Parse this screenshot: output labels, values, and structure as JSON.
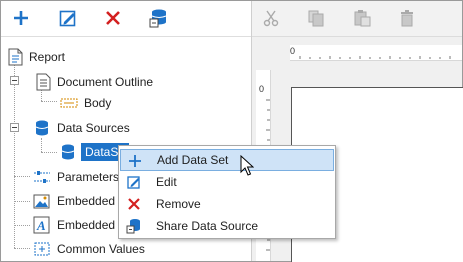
{
  "toolbar_left": {
    "buttons": [
      {
        "icon": "plus-icon"
      },
      {
        "icon": "edit-icon"
      },
      {
        "icon": "delete-icon"
      },
      {
        "icon": "data-source-icon"
      }
    ]
  },
  "toolbar_right": {
    "buttons": [
      {
        "icon": "cut-icon"
      },
      {
        "icon": "copy-icon"
      },
      {
        "icon": "paste-icon"
      },
      {
        "icon": "trash-icon"
      }
    ]
  },
  "tree": {
    "report": "Report",
    "document_outline": "Document Outline",
    "body": "Body",
    "data_sources": "Data Sources",
    "data_source_item": "DataSo",
    "parameters": "Parameters",
    "embedded_images": "Embedded I",
    "embedded_fonts": "Embedded ",
    "common_values": "Common Values"
  },
  "ruler": {
    "top_mark": "0",
    "left_mark": "0"
  },
  "context_menu": {
    "items": [
      {
        "label": "Add Data Set",
        "icon": "plus-icon",
        "highlighted": true
      },
      {
        "label": "Edit",
        "icon": "edit-icon"
      },
      {
        "label": "Remove",
        "icon": "delete-icon"
      },
      {
        "label": "Share Data Source",
        "icon": "share-data-source-icon"
      }
    ]
  },
  "colors": {
    "accent": "#1e73c8",
    "delete_red": "#d32020",
    "highlight": "#cfe3f7"
  }
}
